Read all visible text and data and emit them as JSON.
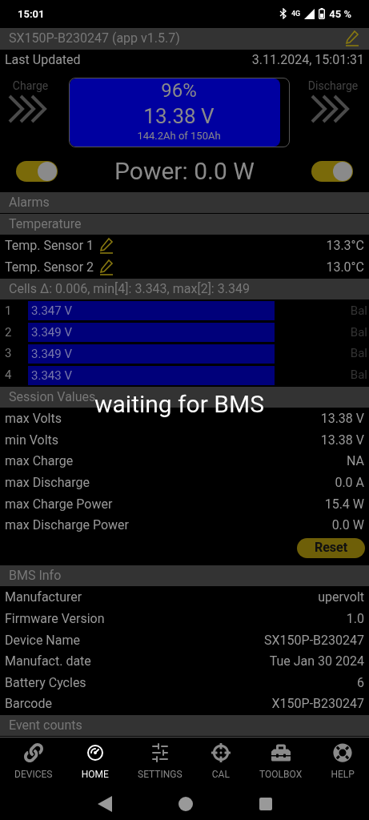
{
  "status_bar": {
    "time": "15:01",
    "network": "4G",
    "battery": "45 %"
  },
  "app_bar": {
    "title": "SX150P-B230247 (app v1.5.7)"
  },
  "last_updated": {
    "label": "Last Updated",
    "value": "3.11.2024, 15:01:31"
  },
  "battery": {
    "charge_label": "Charge",
    "discharge_label": "Discharge",
    "percent": "96%",
    "voltage": "13.38 V",
    "capacity": "144.2Ah of 150Ah",
    "level": 0.96
  },
  "power": {
    "charge_switch": {
      "on": true
    },
    "text": "Power: 0.0 W",
    "discharge_switch": {
      "on": true
    }
  },
  "alarms": {
    "title": "Alarms"
  },
  "temperature": {
    "title": "Temperature",
    "sensors": [
      {
        "label": "Temp. Sensor 1",
        "value": "13.3°C"
      },
      {
        "label": "Temp. Sensor 2",
        "value": "13.0°C"
      }
    ]
  },
  "cells": {
    "title": "Cells Δ: 0.006, min[4]: 3.343, max[2]: 3.349",
    "rows": [
      {
        "index": "1",
        "voltage": "3.347 V",
        "status": "Bal"
      },
      {
        "index": "2",
        "voltage": "3.349 V",
        "status": "Bal"
      },
      {
        "index": "3",
        "voltage": "3.349 V",
        "status": "Bal"
      },
      {
        "index": "4",
        "voltage": "3.343 V",
        "status": "Bal"
      }
    ]
  },
  "session_values": {
    "title": "Session Values",
    "rows": [
      {
        "label": "max Volts",
        "value": "13.38 V"
      },
      {
        "label": "min Volts",
        "value": "13.38 V"
      },
      {
        "label": "max Charge",
        "value": "NA"
      },
      {
        "label": "max Discharge",
        "value": "0.0 A"
      },
      {
        "label": "max Charge Power",
        "value": "15.4 W"
      },
      {
        "label": "max Discharge Power",
        "value": "0.0 W"
      }
    ],
    "reset_button": "Reset"
  },
  "overlay": {
    "text": "waiting for BMS"
  },
  "bms_info": {
    "title": "BMS Info",
    "rows": [
      {
        "label": "Manufacturer",
        "value": "upervolt"
      },
      {
        "label": "Firmware Version",
        "value": "1.0"
      },
      {
        "label": "Device Name",
        "value": "SX150P-B230247"
      },
      {
        "label": "Manufact. date",
        "value": "Tue Jan 30 2024"
      },
      {
        "label": "Battery Cycles",
        "value": "6"
      },
      {
        "label": "Barcode",
        "value": "X150P-B230247"
      }
    ]
  },
  "event_counts": {
    "title": "Event counts"
  },
  "bottom_nav": [
    {
      "label": "DEVICES",
      "kind": "link",
      "selected": false
    },
    {
      "label": "HOME",
      "kind": "gauge",
      "selected": true
    },
    {
      "label": "SETTINGS",
      "kind": "sliders",
      "selected": false
    },
    {
      "label": "CAL",
      "kind": "crosshair",
      "selected": false
    },
    {
      "label": "TOOLBOX",
      "kind": "toolbox",
      "selected": false
    },
    {
      "label": "HELP",
      "kind": "lifebuoy",
      "selected": false
    }
  ]
}
